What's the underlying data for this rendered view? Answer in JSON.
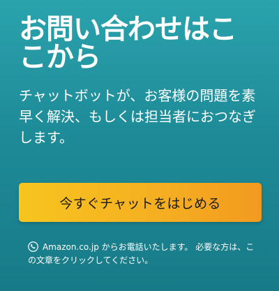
{
  "contact": {
    "title": "お問い合わせはここから",
    "description": "チャットボットが、お客様の問題を素早く解決、もしくは担当者におつなぎします。",
    "chat_button_label": "今すぐチャットをはじめる",
    "call_notice": "Amazon.co.jp からお電話いたします。 必要な方は、この文章をクリックしてください。",
    "icons": {
      "call": "phone-icon"
    },
    "colors": {
      "background_top": "#2aa3ad",
      "background_bottom": "#187a87",
      "button_left": "#f7c51f",
      "button_right": "#f29a20",
      "text": "#ffffff",
      "button_text": "#1b1b1b"
    }
  }
}
